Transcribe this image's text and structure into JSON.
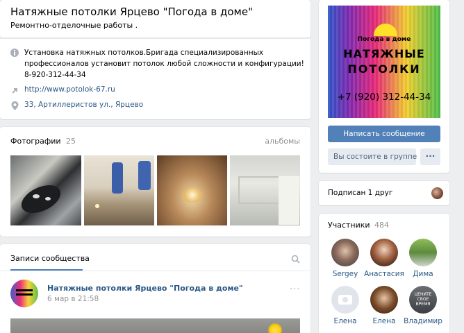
{
  "group": {
    "title": "Натяжные потолки Ярцево \"Погода в доме\"",
    "category": "Ремонтно-отделочные работы ."
  },
  "info": {
    "description_line1": "Установка натяжных потолков.Бригада специализированных",
    "description_line2": "профессионалов установит потолок любой сложности и конфигурации!",
    "phone": "8-920-312-44-34",
    "website": "http://www.potolok-67.ru",
    "address": "33, Артиллеристов ул., Ярцево"
  },
  "photos": {
    "label": "Фотографии",
    "count": "25",
    "albums_link": "альбомы"
  },
  "posts": {
    "tab_label": "Записи сообщества",
    "author": "Натяжные потолки Ярцево \"Погода в доме\"",
    "date": "6 мар в 21:58"
  },
  "logo": {
    "brand": "Погода в доме",
    "line1": "НАТЯЖНЫЕ",
    "line2": "ПОТОЛКИ",
    "phone": "+7 (920) 312-44-34"
  },
  "actions": {
    "message_button": "Написать сообщение",
    "member_button": "Вы состоите в группе",
    "more_button": "···"
  },
  "subscribed": {
    "text": "Подписан 1 друг"
  },
  "members": {
    "label": "Участники",
    "count": "484",
    "list": [
      {
        "name": "Sergey"
      },
      {
        "name": "Анастасия"
      },
      {
        "name": "Дима"
      },
      {
        "name": "Елена"
      },
      {
        "name": "Елена"
      },
      {
        "name": "Владимир"
      }
    ],
    "avatar_caption": "ЦЕНИТЕ СВОЕ ВРЕМЯ"
  },
  "colors": {
    "link": "#2a5885",
    "button": "#5181b8",
    "background": "#edeef0"
  }
}
